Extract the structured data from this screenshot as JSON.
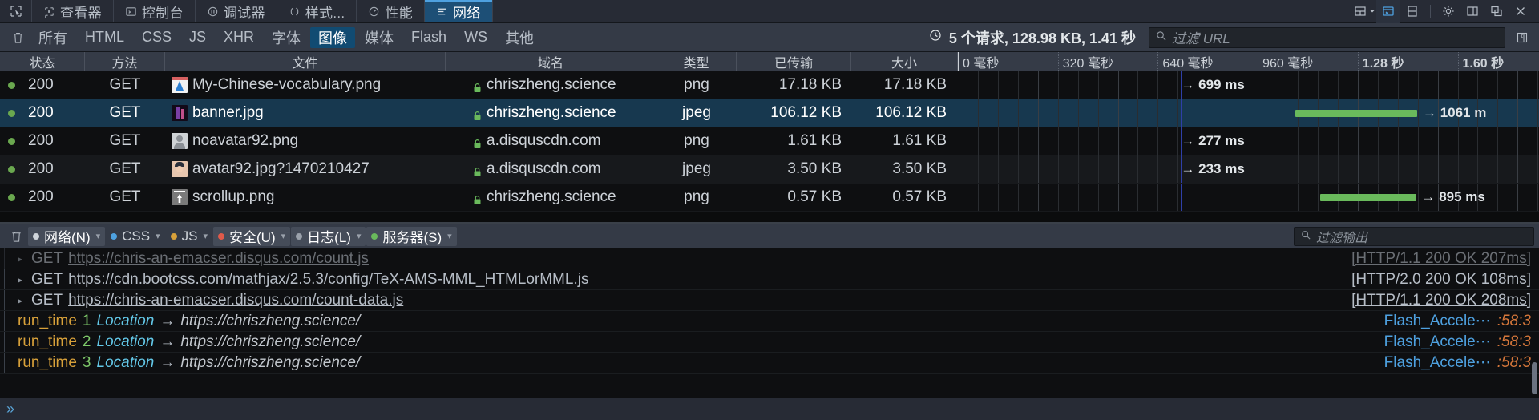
{
  "devtools": {
    "picker_icon": "element-picker-icon",
    "tabs": [
      {
        "label": "查看器",
        "icon": "inspector-icon",
        "selected": false
      },
      {
        "label": "控制台",
        "icon": "console-icon",
        "selected": false
      },
      {
        "label": "调试器",
        "icon": "debugger-icon",
        "selected": false
      },
      {
        "label": "样式...",
        "icon": "style-editor-icon",
        "selected": false
      },
      {
        "label": "性能",
        "icon": "performance-icon",
        "selected": false
      },
      {
        "label": "网络",
        "icon": "network-icon",
        "selected": true
      }
    ],
    "right_icons": [
      {
        "name": "responsive-design-mode-icon",
        "glyph": "layout"
      },
      {
        "name": "toggle-console-icon",
        "glyph": "console",
        "active": true
      },
      {
        "name": "split-panel-icon",
        "glyph": "split"
      },
      {
        "name": "settings-gear-icon",
        "glyph": "gear"
      },
      {
        "name": "dock-side-icon",
        "glyph": "dock"
      },
      {
        "name": "separate-window-icon",
        "glyph": "window"
      },
      {
        "name": "close-devtools-icon",
        "glyph": "close"
      }
    ]
  },
  "network_toolbar": {
    "clear_icon": "trash-icon",
    "filters": [
      {
        "label": "所有",
        "active": false
      },
      {
        "label": "HTML",
        "active": false
      },
      {
        "label": "CSS",
        "active": false
      },
      {
        "label": "JS",
        "active": false
      },
      {
        "label": "XHR",
        "active": false
      },
      {
        "label": "字体",
        "active": false
      },
      {
        "label": "图像",
        "active": true
      },
      {
        "label": "媒体",
        "active": false
      },
      {
        "label": "Flash",
        "active": false
      },
      {
        "label": "WS",
        "active": false
      },
      {
        "label": "其他",
        "active": false
      }
    ],
    "summary_icon": "clock-icon",
    "summary": "5 个请求, 128.98 KB, 1.41 秒",
    "search_icon": "search-icon",
    "filter_placeholder": "过滤 URL",
    "collapse_icon": "collapse-panel-icon"
  },
  "network_table": {
    "columns": [
      {
        "key": "status",
        "label": "状态"
      },
      {
        "key": "method",
        "label": "方法"
      },
      {
        "key": "file",
        "label": "文件"
      },
      {
        "key": "domain",
        "label": "域名"
      },
      {
        "key": "type",
        "label": "类型"
      },
      {
        "key": "transferred",
        "label": "已传输"
      },
      {
        "key": "size",
        "label": "大小"
      }
    ],
    "timeline_ticks": [
      {
        "label": "0 毫秒",
        "pct": 0
      },
      {
        "label": "320 毫秒",
        "pct": 17.2
      },
      {
        "label": "640 毫秒",
        "pct": 34.4
      },
      {
        "label": "960 毫秒",
        "pct": 51.6
      },
      {
        "label": "1.28 秒",
        "pct": 68.8,
        "bold": true
      },
      {
        "label": "1.60 秒",
        "pct": 86.0,
        "bold": true
      }
    ],
    "marker_pct": 38.4,
    "rows": [
      {
        "status": "200",
        "method": "GET",
        "file": "My-Chinese-vocabulary.png",
        "domain": "chriszheng.science",
        "type": "png",
        "transferred": "17.18 KB",
        "size": "17.18 KB",
        "favicon": "image-thumbnail-chart",
        "secure": true,
        "selected": false,
        "wf_start_pct": 38.4,
        "wf_width_pct": 0,
        "wf_label": "→ 699 ms"
      },
      {
        "status": "200",
        "method": "GET",
        "file": "banner.jpg",
        "domain": "chriszheng.science",
        "type": "jpeg",
        "transferred": "106.12 KB",
        "size": "106.12 KB",
        "favicon": "image-thumbnail-banner",
        "secure": true,
        "selected": true,
        "wf_start_pct": 58.0,
        "wf_width_pct": 28.5,
        "wf_label": "→ 1061 m"
      },
      {
        "status": "200",
        "method": "GET",
        "file": "noavatar92.png",
        "domain": "a.disquscdn.com",
        "type": "png",
        "transferred": "1.61 KB",
        "size": "1.61 KB",
        "favicon": "image-thumbnail-avatar-placeholder",
        "secure": true,
        "selected": false,
        "wf_start_pct": 38.4,
        "wf_width_pct": 0,
        "wf_label": "→ 277 ms"
      },
      {
        "status": "200",
        "method": "GET",
        "file": "avatar92.jpg?1470210427",
        "domain": "a.disquscdn.com",
        "type": "jpeg",
        "transferred": "3.50 KB",
        "size": "3.50 KB",
        "favicon": "image-thumbnail-avatar-photo",
        "secure": true,
        "selected": false,
        "wf_start_pct": 38.4,
        "wf_width_pct": 0,
        "wf_label": "→ 233 ms"
      },
      {
        "status": "200",
        "method": "GET",
        "file": "scrollup.png",
        "domain": "chriszheng.science",
        "type": "png",
        "transferred": "0.57 KB",
        "size": "0.57 KB",
        "favicon": "image-thumbnail-scrollup",
        "secure": true,
        "selected": false,
        "wf_start_pct": 62.3,
        "wf_width_pct": 22.4,
        "wf_label": "→ 895 ms"
      }
    ]
  },
  "console_toolbar": {
    "clear_icon": "trash-icon",
    "buttons": [
      {
        "label": "网络(N)",
        "dot": "#cfd4da",
        "active": true,
        "caret": true
      },
      {
        "label": "CSS",
        "dot": "#4ea1e0",
        "active": false,
        "caret": true
      },
      {
        "label": "JS",
        "dot": "#d8a13a",
        "active": false,
        "caret": true
      },
      {
        "label": "安全(U)",
        "dot": "#e05a4a",
        "active": true,
        "caret": true
      },
      {
        "label": "日志(L)",
        "dot": "#9aa1ab",
        "active": true,
        "caret": true
      },
      {
        "label": "服务器(S)",
        "dot": "#6aba5c",
        "active": true,
        "caret": true
      }
    ],
    "search_icon": "search-icon",
    "filter_placeholder": "过滤输出"
  },
  "console_lines": [
    {
      "kind": "network",
      "partial": true,
      "twisty": "▸",
      "method": "GET",
      "url": "https://chris-an-emacser.disqus.com/count.js",
      "status": "[HTTP/1.1 200 OK 207ms]"
    },
    {
      "kind": "network",
      "partial": false,
      "twisty": "▸",
      "method": "GET",
      "url": "https://cdn.bootcss.com/mathjax/2.5.3/config/TeX-AMS-MML_HTMLorMML.js",
      "status": "[HTTP/2.0 200 OK 108ms]"
    },
    {
      "kind": "network",
      "partial": false,
      "twisty": "▸",
      "method": "GET",
      "url": "https://chris-an-emacser.disqus.com/count-data.js",
      "status": "[HTTP/1.1 200 OK 208ms]"
    },
    {
      "kind": "log",
      "name": "run_time",
      "num": "1",
      "key": "Location",
      "arrow": "→",
      "value": "https://chriszheng.science/",
      "source": "Flash_Accele⋯",
      "source_line": ":58:3"
    },
    {
      "kind": "log",
      "name": "run_time",
      "num": "2",
      "key": "Location",
      "arrow": "→",
      "value": "https://chriszheng.science/",
      "source": "Flash_Accele⋯",
      "source_line": ":58:3"
    },
    {
      "kind": "log",
      "name": "run_time",
      "num": "3",
      "key": "Location",
      "arrow": "→",
      "value": "https://chriszheng.science/",
      "source": "Flash_Accele⋯",
      "source_line": ":58:3"
    }
  ],
  "console_input": {
    "prompt": "»",
    "value": ""
  },
  "colors": {
    "accent": "#4ea1e0",
    "selected_tab_bg": "#1d4f76",
    "filter_active_bg": "#114b72",
    "row_selected_bg": "#17384f",
    "waterfall_bar": "#6aba5c",
    "status_ok_dot": "#6aa84f",
    "lock_secure": "#6aba5c",
    "marker_line": "#2f3fa8"
  }
}
